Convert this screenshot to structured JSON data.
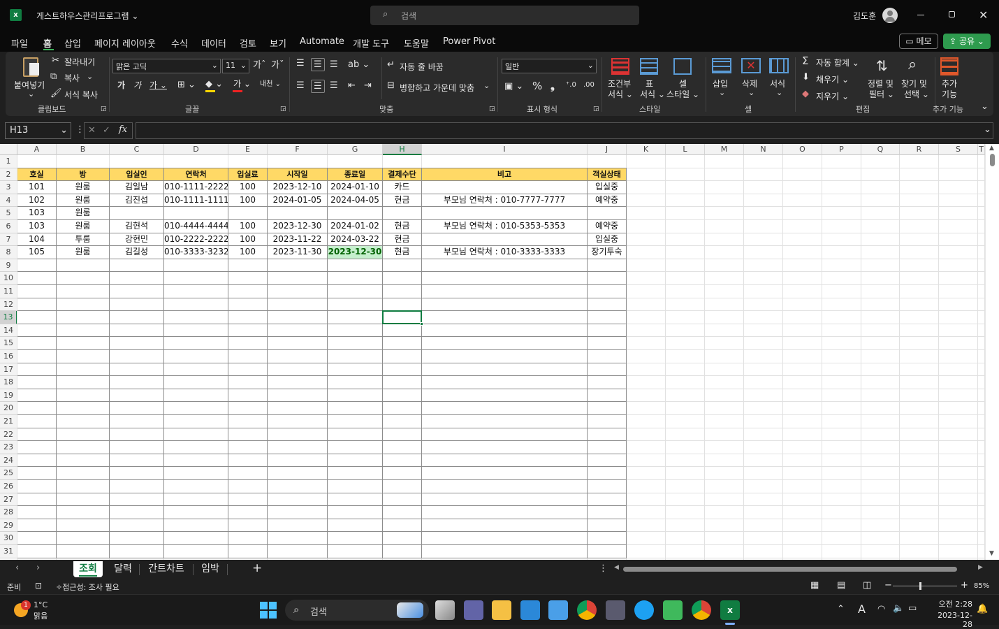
{
  "titlebar": {
    "file_name": "게스트하우스관리프로그램",
    "search_placeholder": "검색",
    "user_name": "김도훈"
  },
  "menu": {
    "tabs": [
      "파일",
      "홈",
      "삽입",
      "페이지 레이아웃",
      "수식",
      "데이터",
      "검토",
      "보기",
      "Automate",
      "개발 도구",
      "도움말",
      "Power Pivot"
    ],
    "memo_label": "메모",
    "share_label": "공유"
  },
  "ribbon": {
    "paste_label": "붙여넣기",
    "cut_label": "잘라내기",
    "copy_label": "복사",
    "format_painter_label": "서식 복사",
    "clipboard_group": "클립보드",
    "font_name": "맑은 고딕",
    "font_size": "11",
    "font_group": "글꼴",
    "wrap_text_label": "자동 줄 바꿈",
    "merge_center_label": "병합하고 가운데 맞춤",
    "align_group": "맞춤",
    "number_format": "일반",
    "number_group": "표시 형식",
    "cond_format_label1": "조건부",
    "cond_format_label2": "서식",
    "table_format_label1": "표",
    "table_format_label2": "서식",
    "cell_style_label1": "셀",
    "cell_style_label2": "스타일",
    "style_group": "스타일",
    "insert_label": "삽입",
    "delete_label": "삭제",
    "format_label": "서식",
    "cells_group": "셀",
    "autosum_label": "자동 합계",
    "fill_label": "채우기",
    "clear_label": "지우기",
    "sort_label1": "정렬 및",
    "sort_label2": "필터",
    "find_label1": "찾기 및",
    "find_label2": "선택",
    "edit_group": "편집",
    "addins_label1": "추가",
    "addins_label2": "기능",
    "addins_group": "추가 기능"
  },
  "formula_bar": {
    "name_box": "H13",
    "fx": "fx",
    "formula": ""
  },
  "grid": {
    "columns": [
      "A",
      "B",
      "C",
      "D",
      "E",
      "F",
      "G",
      "H",
      "I",
      "J",
      "K",
      "L",
      "M",
      "N",
      "O",
      "P",
      "Q",
      "R",
      "S",
      "T"
    ],
    "rows": [
      "1",
      "2",
      "3",
      "4",
      "5",
      "6",
      "7",
      "8",
      "9",
      "10",
      "11",
      "12",
      "13",
      "14",
      "15",
      "16",
      "17",
      "18",
      "19",
      "20",
      "21",
      "22",
      "23",
      "24",
      "25",
      "26",
      "27",
      "28",
      "29",
      "30",
      "31"
    ],
    "headers": [
      "호실",
      "방",
      "입실인",
      "연락처",
      "입실료",
      "시작일",
      "종료일",
      "결제수단",
      "비고",
      "객실상태"
    ],
    "data": [
      [
        "101",
        "원룸",
        "김일남",
        "010-1111-2222",
        "100",
        "2023-12-10",
        "2024-01-10",
        "카드",
        "",
        "입실중"
      ],
      [
        "102",
        "원룸",
        "김진섭",
        "010-1111-1111",
        "100",
        "2024-01-05",
        "2024-04-05",
        "현금",
        "부모님 연락처 : 010-7777-7777",
        "예약중"
      ],
      [
        "103",
        "원룸",
        "",
        "",
        "",
        "",
        "",
        "",
        "",
        ""
      ],
      [
        "103",
        "원룸",
        "김현석",
        "010-4444-4444",
        "100",
        "2023-12-30",
        "2024-01-02",
        "현금",
        "부모님 연락처 : 010-5353-5353",
        "예약중"
      ],
      [
        "104",
        "투룸",
        "강현민",
        "010-2222-2222",
        "100",
        "2023-11-22",
        "2024-03-22",
        "현금",
        "",
        "입실중"
      ],
      [
        "105",
        "원룸",
        "김길성",
        "010-3333-3232",
        "100",
        "2023-11-30",
        "2023-12-30",
        "현금",
        "부모님 연락처 : 010-3333-3333",
        "장기투숙"
      ]
    ],
    "highlight_fill": "#c6efce",
    "header_fill": "#ffd966"
  },
  "sheets": {
    "tabs": [
      "조회",
      "달력",
      "간트차트",
      "임박"
    ],
    "active": "조회"
  },
  "status": {
    "ready": "준비",
    "accessibility": "접근성: 조사 필요",
    "zoom": "85%"
  },
  "taskbar": {
    "weather_temp": "1°C",
    "weather_desc": "맑음",
    "weather_badge": "1",
    "search_label": "검색",
    "ime": "A",
    "time": "오전 2:28",
    "date": "2023-12-28"
  },
  "colors": {
    "excel_green": "#107c41",
    "share_green": "#2e9b4e"
  }
}
